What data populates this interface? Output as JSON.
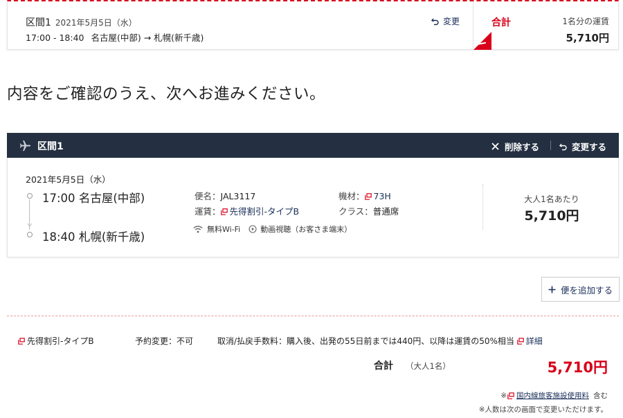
{
  "summary": {
    "segment_label": "区間1",
    "date": "2021年5月5日（水）",
    "time_range": "17:00 - 18:40",
    "route": "名古屋(中部) → 札幌(新千歳)",
    "change_label": "変更",
    "total_label": "合計",
    "per_person_label": "1名分の運賃",
    "price": "5,710円"
  },
  "headline": "内容をご確認のうえ、次へお進みください。",
  "segment": {
    "title": "区間1",
    "delete_label": "削除する",
    "change_label": "変更する",
    "date": "2021年5月5日（水）",
    "dep_time": "17:00",
    "dep_airport": "名古屋(中部)",
    "arr_time": "18:40",
    "arr_airport": "札幌(新千歳)",
    "flight_label": "便名：",
    "flight_no": "JAL3117",
    "fare_label": "運賃：",
    "fare_name": "先得割引-タイプB",
    "aircraft_label": "機材：",
    "aircraft": "73H",
    "class_label": "クラス：",
    "class_value": "普通席",
    "amenity_wifi": "無料Wi-Fi",
    "amenity_video": "動画視聴（お客さま端末）",
    "adult_label": "大人1名あたり",
    "adult_price": "5,710円"
  },
  "add_flight_label": "便を追加する",
  "bottom": {
    "fare_name": "先得割引-タイプB",
    "change_rule": "予約変更：不可",
    "cancel_rule": "取消/払戻手数料：購入後、出発の55日前までは440円、以降は運賃の50%相当",
    "detail_label": "詳細",
    "total_label": "合計",
    "total_sub": "（大人1名）",
    "total_price": "5,710円",
    "note1_prefix": "※",
    "note1_link": "国内線旅客施設使用料",
    "note1_suffix": "含む",
    "note2": "※人数は次の画面で変更いただけます。"
  },
  "colors": {
    "accent_red": "#d8001a",
    "navy": "#243041",
    "link": "#1a2f5a"
  }
}
